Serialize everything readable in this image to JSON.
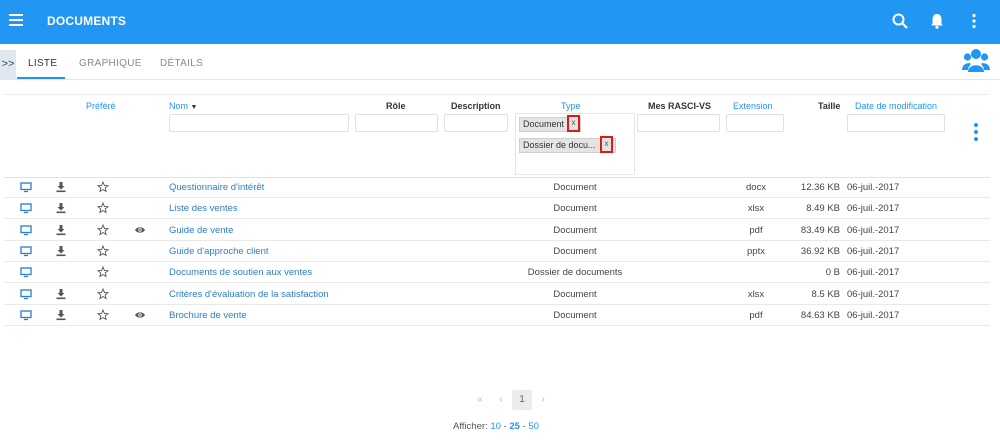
{
  "app": {
    "title": "DOCUMENTS",
    "icons": [
      "menu-icon",
      "search-icon",
      "bell-icon",
      "more-vert-icon"
    ],
    "accent": "#2196f3"
  },
  "tabs": {
    "expand": ">>",
    "items": [
      "LISTE",
      "GRAPHIQUE",
      "DÉTAILS"
    ],
    "active": "LISTE"
  },
  "table": {
    "headers": {
      "prefere": "Préféré",
      "nom": "Nom",
      "role": "Rôle",
      "description": "Description",
      "type": "Type",
      "rasci": "Mes RASCI-VS",
      "extension": "Extension",
      "taille": "Taille",
      "date": "Date de modification"
    },
    "type_filters": [
      "Document",
      "Dossier de docu..."
    ],
    "filter_chip_remove": "x",
    "rows": [
      {
        "name": "Questionnaire d'intérêt",
        "type": "Document",
        "ext": "docx",
        "size": "12.36 KB",
        "date": "06-juil.-2017",
        "download": true,
        "view": false
      },
      {
        "name": "Liste des ventes",
        "type": "Document",
        "ext": "xlsx",
        "size": "8.49 KB",
        "date": "06-juil.-2017",
        "download": true,
        "view": false
      },
      {
        "name": "Guide de vente",
        "type": "Document",
        "ext": "pdf",
        "size": "83.49 KB",
        "date": "06-juil.-2017",
        "download": true,
        "view": true
      },
      {
        "name": "Guide d'approche client",
        "type": "Document",
        "ext": "pptx",
        "size": "36.92 KB",
        "date": "06-juil.-2017",
        "download": true,
        "view": false
      },
      {
        "name": "Documents de soutien aux ventes",
        "type": "Dossier de documents",
        "ext": "",
        "size": "0 B",
        "date": "06-juil.-2017",
        "download": false,
        "view": false
      },
      {
        "name": "Critères d'évaluation de la satisfaction",
        "type": "Document",
        "ext": "xlsx",
        "size": "8.5 KB",
        "date": "06-juil.-2017",
        "download": true,
        "view": false
      },
      {
        "name": "Brochure de vente",
        "type": "Document",
        "ext": "pdf",
        "size": "84.63 KB",
        "date": "06-juil.-2017",
        "download": true,
        "view": true
      }
    ]
  },
  "pagination": {
    "first": "«",
    "prev": "‹",
    "current": "1",
    "next": "›",
    "show_label": "Afficher:",
    "options": [
      "10",
      "25",
      "50"
    ],
    "selected": "25",
    "separator": " - "
  }
}
